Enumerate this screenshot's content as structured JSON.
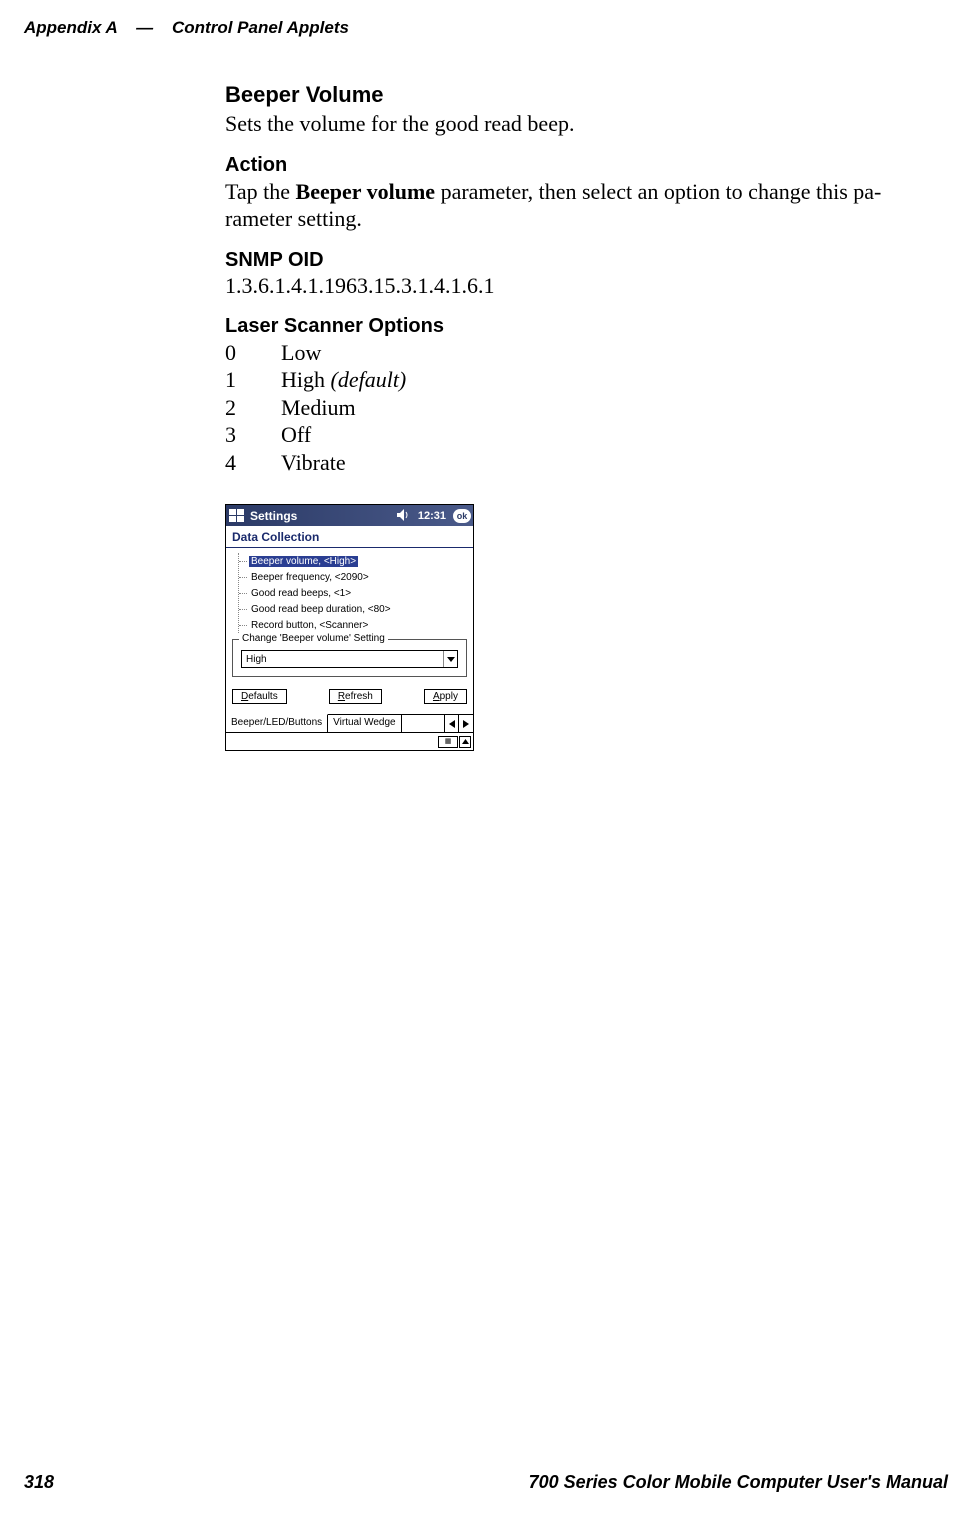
{
  "header": {
    "appendix": "Appendix  A",
    "sep": "—",
    "chapter": "Control Panel Applets"
  },
  "sections": {
    "beeper_volume_title": "Beeper Volume",
    "beeper_volume_text": "Sets the volume for the good read beep.",
    "action_title": "Action",
    "action_pre": "Tap the ",
    "action_bold": "Beeper volume",
    "action_post": " parameter, then select an option to change this pa-rameter setting.",
    "snmp_title": "SNMP OID",
    "snmp_value": "1.3.6.1.4.1.1963.15.3.1.4.1.6.1",
    "options_title": "Laser Scanner Options",
    "options": [
      {
        "num": "0",
        "label": "Low",
        "note": ""
      },
      {
        "num": "1",
        "label": "High ",
        "note": "(default)"
      },
      {
        "num": "2",
        "label": "Medium",
        "note": ""
      },
      {
        "num": "3",
        "label": "Off",
        "note": ""
      },
      {
        "num": "4",
        "label": "Vibrate",
        "note": ""
      }
    ]
  },
  "pda": {
    "titlebar": "Settings",
    "time": "12:31",
    "ok": "ok",
    "subtitle": "Data Collection",
    "tree": [
      "Beeper volume, <High>",
      "Beeper frequency, <2090>",
      "Good read beeps, <1>",
      "Good read beep duration, <80>",
      "Record button, <Scanner>"
    ],
    "fieldset_legend": "Change 'Beeper volume' Setting",
    "dropdown_value": "High",
    "buttons": {
      "defaults_pre": "D",
      "defaults_rest": "efaults",
      "refresh_pre": "R",
      "refresh_rest": "efresh",
      "apply_pre": "A",
      "apply_rest": "pply"
    },
    "tabs": {
      "active": "Beeper/LED/Buttons",
      "other": "Virtual Wedge"
    }
  },
  "footer": {
    "page": "318",
    "manual": "700 Series Color Mobile Computer User's Manual"
  }
}
